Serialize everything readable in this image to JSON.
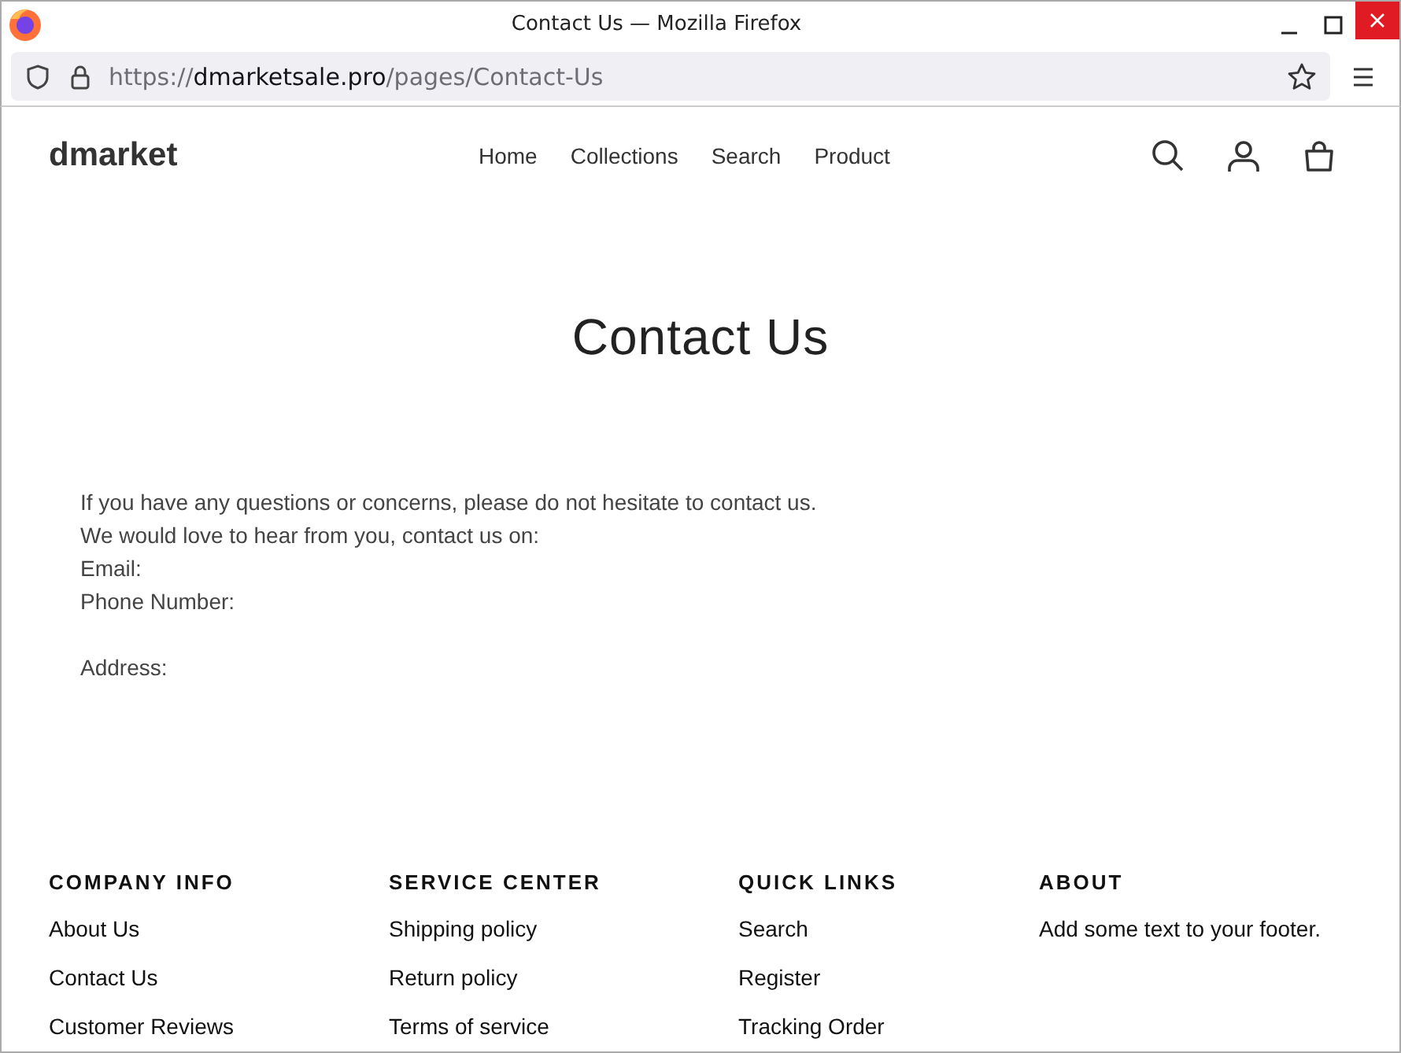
{
  "window": {
    "title": "Contact Us — Mozilla Firefox"
  },
  "address_bar": {
    "scheme": "https://",
    "host": "dmarketsale.pro",
    "path": "/pages/Contact-Us"
  },
  "site": {
    "logo": "dmarket",
    "nav": [
      "Home",
      "Collections",
      "Search",
      "Product"
    ]
  },
  "page": {
    "heading": "Contact Us",
    "lines": [
      "If you have any questions or concerns, please do not hesitate to contact us.",
      "We would love to hear from you, contact us on:",
      "Email:",
      "Phone Number:"
    ],
    "address": "Address:"
  },
  "footer": {
    "columns": [
      {
        "heading": "COMPANY INFO",
        "links": [
          "About Us",
          "Contact Us",
          "Customer Reviews"
        ]
      },
      {
        "heading": "SERVICE CENTER",
        "links": [
          "Shipping policy",
          "Return policy",
          "Terms of service"
        ]
      },
      {
        "heading": "QUICK LINKS",
        "links": [
          "Search",
          "Register",
          "Tracking Order"
        ]
      },
      {
        "heading": "ABOUT",
        "text": "Add some text to your footer."
      }
    ]
  }
}
